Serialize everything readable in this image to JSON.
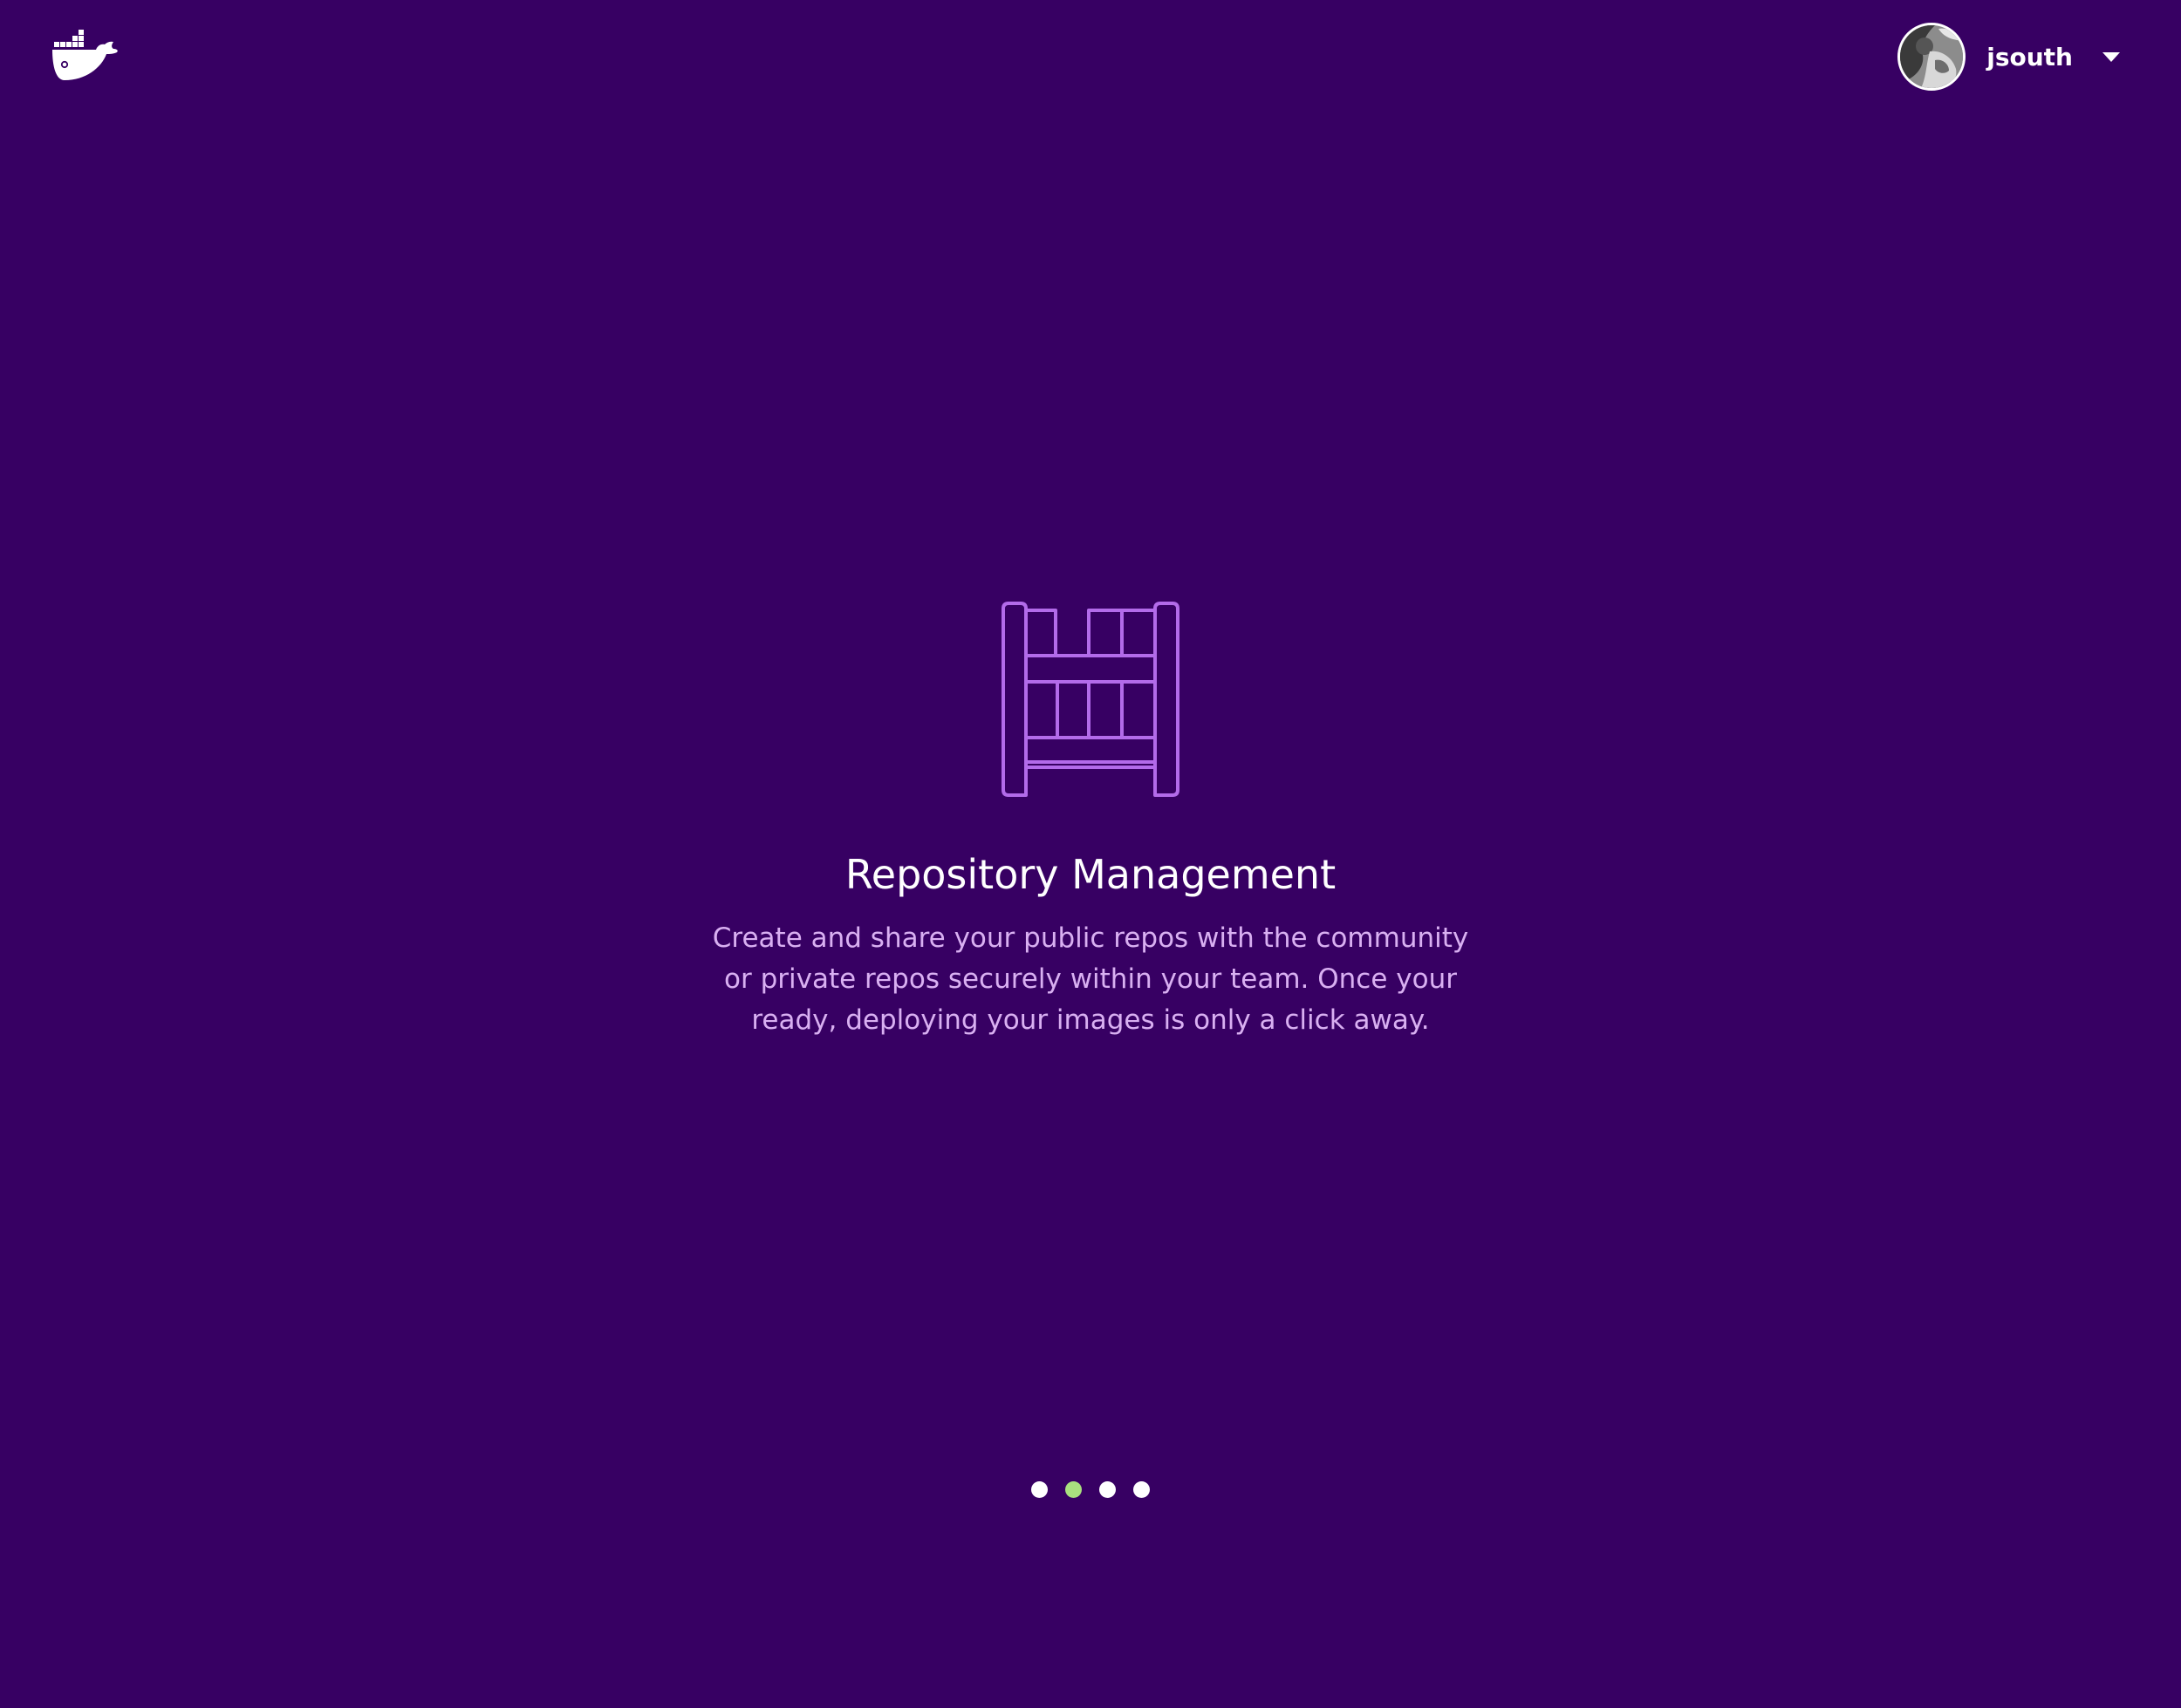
{
  "header": {
    "logo_icon": "docker-whale-icon",
    "user": {
      "username": "jsouth",
      "avatar_icon": "user-avatar",
      "menu_icon": "caret-down-icon"
    }
  },
  "feature": {
    "icon": "repository-shelf-icon",
    "title": "Repository Management",
    "description": "Create and share your public repos with the community or private repos securely within your team. Once your ready, deploying your images is only a click away."
  },
  "carousel": {
    "total": 4,
    "active_index": 1
  },
  "colors": {
    "background": "#370063",
    "accent_icon": "#b36bea",
    "description_text": "#d9b0f2",
    "active_dot": "#a9e07f"
  }
}
